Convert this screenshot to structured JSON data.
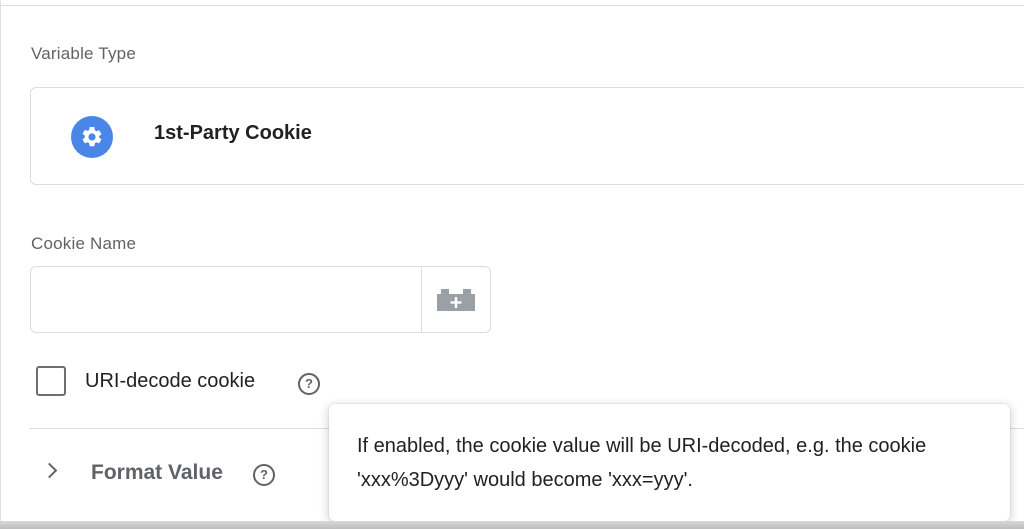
{
  "variable_type": {
    "label": "Variable Type",
    "selected": "1st-Party Cookie",
    "icon": "gear-icon",
    "icon_color": "#4a86e8"
  },
  "cookie_name": {
    "label": "Cookie Name",
    "value": "",
    "placeholder": "",
    "picker_icon": "variable-picker-icon"
  },
  "uri_decode": {
    "label": "URI-decode cookie",
    "checked": false,
    "help_glyph": "?"
  },
  "format_value": {
    "label": "Format Value",
    "help_glyph": "?"
  },
  "tooltip": {
    "text": "If enabled, the cookie value will be URI-decoded, e.g. the cookie 'xxx%3Dyyy' would become 'xxx=yyy'."
  }
}
